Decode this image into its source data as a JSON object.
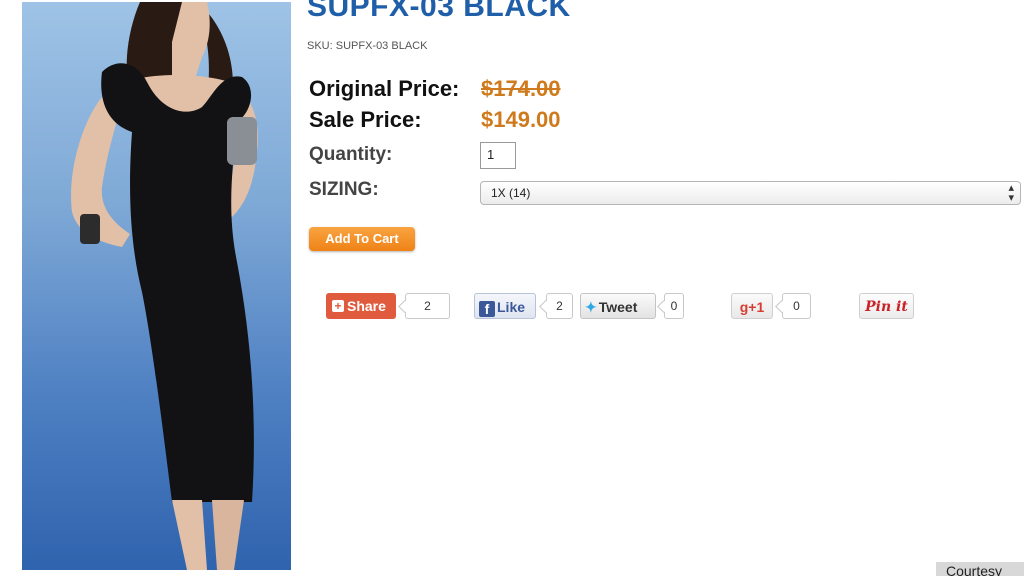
{
  "product": {
    "title": "SUPFX-03 BLACK",
    "sku": "SKU: SUPFX-03 BLACK",
    "original_price_label": "Original Price:",
    "original_price": "$174.00",
    "sale_price_label": "Sale Price:",
    "sale_price": "$149.00",
    "quantity_label": "Quantity:",
    "quantity_value": "1",
    "sizing_label": "SIZING:",
    "sizing_selected": "1X (14)",
    "add_to_cart_label": "Add To Cart"
  },
  "social": {
    "share_label": "Share",
    "share_count": "2",
    "like_label": "Like",
    "like_count": "2",
    "tweet_label": "Tweet",
    "tweet_count": "0",
    "gplus_label": "+1",
    "gplus_count": "0",
    "pin_label": "Pin it"
  },
  "credit": {
    "courtesy": "Courtesy"
  },
  "colors": {
    "title": "#1f5ea8",
    "price": "#cf7a1c",
    "cart_button": "#ef8216",
    "share_button": "#e05a3e"
  },
  "icons": [
    "share-plus-icon",
    "facebook-icon",
    "twitter-bird-icon",
    "google-plus-icon",
    "select-arrows-icon"
  ]
}
